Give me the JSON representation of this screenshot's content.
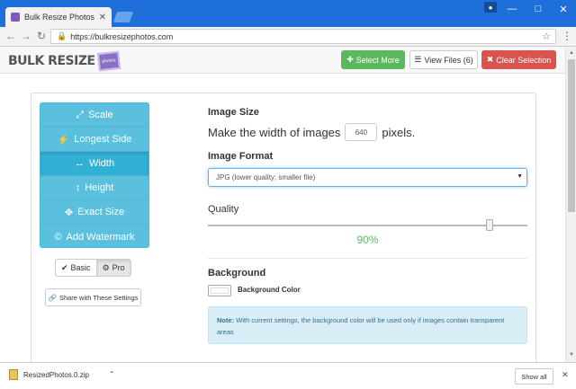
{
  "browser": {
    "tab_title": "Bulk Resize Photos",
    "tab_close": "✕",
    "url": "https://bulkresizephotos.com",
    "icons": [
      "back-icon",
      "forward-icon",
      "reload-icon",
      "lock-icon",
      "star-icon",
      "menu-icon",
      "user-icon"
    ]
  },
  "header": {
    "logo_text": "BULK RESIZE",
    "logo_badge": "photos",
    "select_more": "Select More",
    "view_files": "View Files (6)",
    "clear_selection": "Clear Selection"
  },
  "sidebar": {
    "items": [
      {
        "label": "Scale",
        "icon": "scale-icon",
        "active": false
      },
      {
        "label": "Longest Side",
        "icon": "bolt-icon",
        "active": false
      },
      {
        "label": "Width",
        "icon": "horizontal-arrows-icon",
        "active": true
      },
      {
        "label": "Height",
        "icon": "vertical-arrows-icon",
        "active": false
      },
      {
        "label": "Exact Size",
        "icon": "move-icon",
        "active": false
      },
      {
        "label": "Add Watermark",
        "icon": "copyright-icon",
        "active": false
      }
    ],
    "mode_basic": "Basic",
    "mode_pro": "Pro",
    "mode_selected": "Pro",
    "share_label": "Share with These Settings"
  },
  "form": {
    "image_size_label": "Image Size",
    "size_prefix": "Make the width of images",
    "size_value": "640",
    "size_suffix": "pixels.",
    "format_label": "Image Format",
    "format_value": "JPG (lower quality; smaller file)",
    "quality_label": "Quality",
    "quality_value": "90%",
    "quality_fraction": 0.9,
    "background_label": "Background",
    "background_color_label": "Background Color",
    "background_color": "#ffffff",
    "note_bold": "Note:",
    "note_text": " With current settings, the background color will be used only if images contain transparent areas"
  },
  "downloads": {
    "file_name": "ResizedPhotos.0.zip",
    "show_all": "Show all"
  },
  "colors": {
    "chrome_blue": "#1e6fd9",
    "nav_info": "#5bc0de",
    "green": "#5cb85c",
    "red": "#d9534f"
  }
}
